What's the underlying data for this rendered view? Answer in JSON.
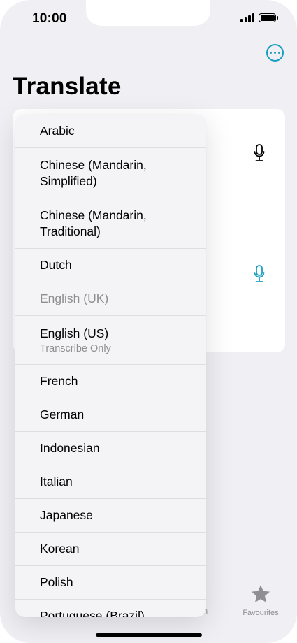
{
  "status_bar": {
    "time": "10:00"
  },
  "header": {
    "title": "Translate"
  },
  "tab_bar": {
    "favourites_label": "Favourites",
    "partial_label": "n"
  },
  "menu": {
    "items": [
      {
        "label": "Arabic"
      },
      {
        "label": "Chinese (Mandarin, Simplified)"
      },
      {
        "label": "Chinese (Mandarin, Traditional)"
      },
      {
        "label": "Dutch"
      },
      {
        "label": "English (UK)"
      },
      {
        "label": "English (US)",
        "sublabel": "Transcribe Only"
      },
      {
        "label": "French"
      },
      {
        "label": "German"
      },
      {
        "label": "Indonesian"
      },
      {
        "label": "Italian"
      },
      {
        "label": "Japanese"
      },
      {
        "label": "Korean"
      },
      {
        "label": "Polish"
      },
      {
        "label": "Portuguese (Brazil)"
      }
    ],
    "disabled_item": "English (UK)"
  },
  "colors": {
    "accent": "#1a9fbe",
    "background": "#efeff4",
    "secondary_text": "#8e8e93"
  },
  "icons": {
    "more": "ellipsis-circle",
    "mic": "microphone",
    "favourites": "star"
  }
}
